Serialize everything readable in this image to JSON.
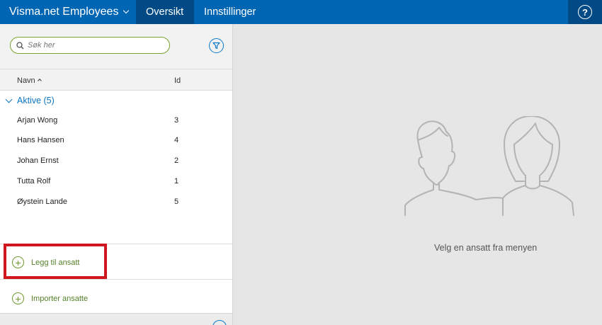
{
  "app": {
    "title": "Visma.net Employees"
  },
  "nav": {
    "tabs": [
      {
        "label": "Oversikt"
      },
      {
        "label": "Innstillinger"
      }
    ],
    "help_label": "?"
  },
  "search": {
    "placeholder": "Søk her",
    "value": ""
  },
  "columns": {
    "name": "Navn",
    "id": "Id"
  },
  "group": {
    "label": "Aktive (5)"
  },
  "employees": [
    {
      "name": "Arjan Wong",
      "id": "3"
    },
    {
      "name": "Hans Hansen",
      "id": "4"
    },
    {
      "name": "Johan Ernst",
      "id": "2"
    },
    {
      "name": "Tutta Rolf",
      "id": "1"
    },
    {
      "name": "Øystein Lande",
      "id": "5"
    }
  ],
  "actions": {
    "add_label": "Legg til ansatt",
    "import_label": "Importer ansatte"
  },
  "empty_state": {
    "message": "Velg en ansatt fra menyen"
  },
  "colors": {
    "topbar": "#0065b3",
    "topbar_active": "#014a86",
    "accent_green": "#6c9a2d",
    "link_blue": "#0a74c2",
    "highlight_red": "#d0171f"
  }
}
